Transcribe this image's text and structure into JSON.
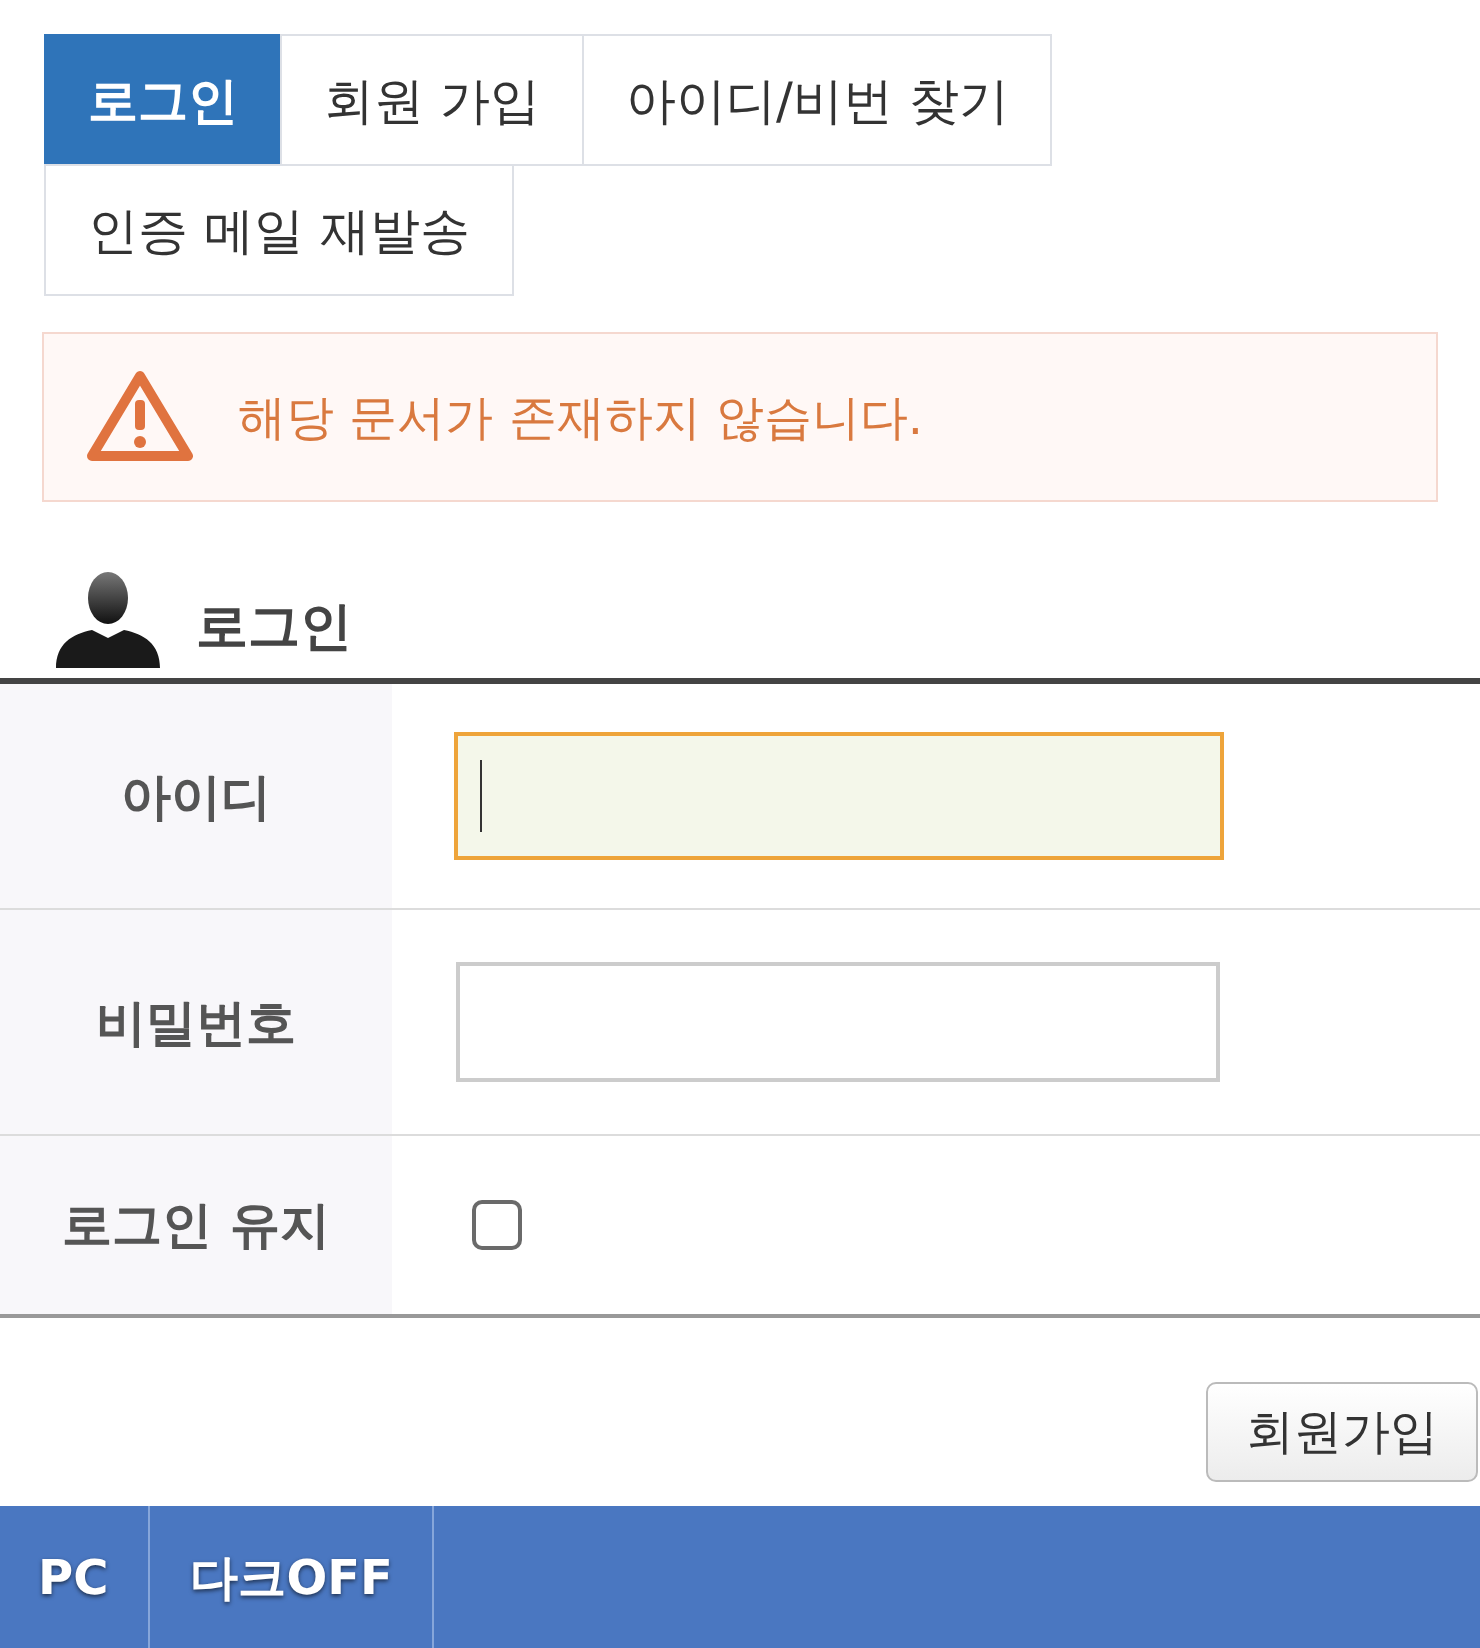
{
  "tabs": [
    {
      "label": "로그인",
      "selected": true
    },
    {
      "label": "회원 가입",
      "selected": false
    },
    {
      "label": "아이디/비번 찾기",
      "selected": false
    },
    {
      "label": "인증 메일 재발송",
      "selected": false
    }
  ],
  "alert": {
    "message": "해당 문서가 존재하지 않습니다."
  },
  "login": {
    "title": "로그인",
    "fields": [
      {
        "kind": "text",
        "label": "아이디",
        "focused": true
      },
      {
        "kind": "password",
        "label": "비밀번호",
        "focused": false
      },
      {
        "kind": "checkbox",
        "label": "로그인 유지",
        "checked": false
      }
    ]
  },
  "buttons": [
    {
      "label": "회원가입"
    }
  ],
  "footer": {
    "items": [
      {
        "label": "PC"
      },
      {
        "label": "다크OFF"
      }
    ]
  }
}
